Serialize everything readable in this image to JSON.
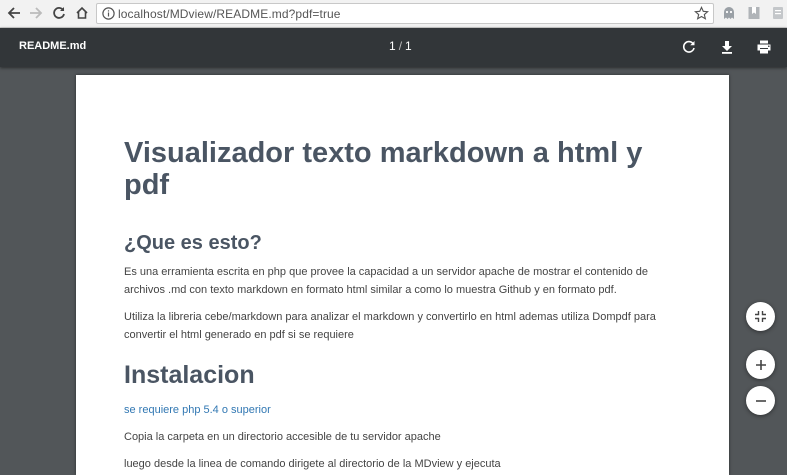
{
  "browser": {
    "url": "localhost/MDview/README.md?pdf=true",
    "back_icon": "back-arrow-icon",
    "forward_icon": "forward-arrow-icon",
    "reload_icon": "reload-icon",
    "home_icon": "home-icon",
    "info_icon": "info-icon",
    "bookmark_icon": "star-icon",
    "extensions": [
      "ghost-extension-icon",
      "bookmark-extension-icon",
      "page-extension-icon",
      "skype-extension-icon"
    ]
  },
  "pdf_toolbar": {
    "filename": "README.md",
    "current_page": "1",
    "separator": "/",
    "total_pages": "1",
    "rotate_icon": "rotate-icon",
    "download_icon": "download-icon",
    "print_icon": "print-icon"
  },
  "document": {
    "title": "Visualizador texto markdown a html y pdf",
    "section1_heading": "¿Que es esto?",
    "section1_p1": "Es una erramienta escrita en php que provee la capacidad a un servidor apache de mostrar el contenido de archivos .md con texto markdown en formato html similar a como lo muestra Github y en formato pdf.",
    "section1_p2": "Utiliza la libreria cebe/markdown para analizar el markdown y convertirlo en html ademas utiliza Dompdf para convertir el html generado en pdf si se requiere",
    "section2_heading": "Instalacion",
    "section2_link": "se requiere php 5.4 o superior",
    "section2_p1": "Copia la carpeta en un directorio accesible de tu servidor apache",
    "section2_p2": "luego desde la linea de comando dirigete al directorio de la MDview y ejecuta"
  },
  "zoom_controls": {
    "fit_icon": "fit-to-page-icon",
    "zoom_in_icon": "zoom-in-icon",
    "zoom_out_icon": "zoom-out-icon"
  }
}
